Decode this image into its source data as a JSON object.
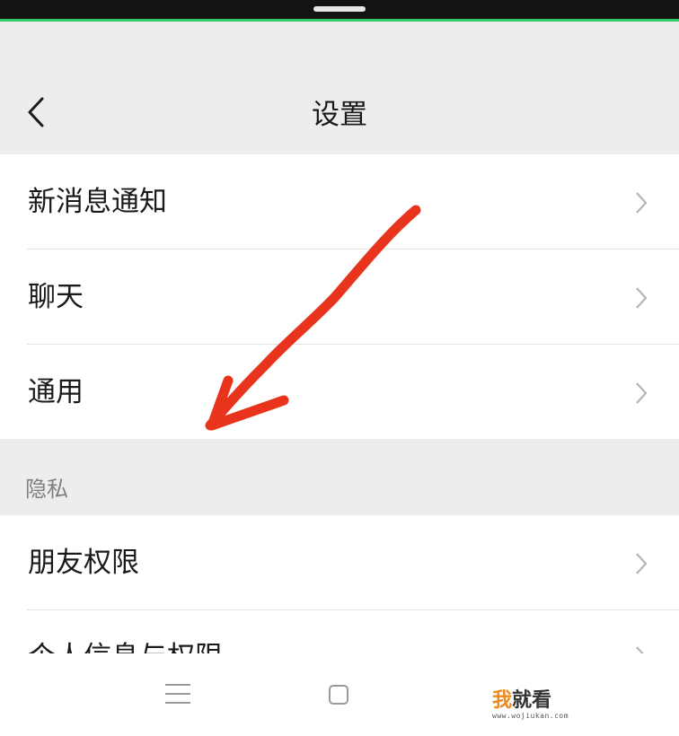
{
  "header": {
    "title": "设置",
    "back_icon": "back-chevron-icon"
  },
  "settings_group_1": {
    "items": [
      {
        "label": "新消息通知"
      },
      {
        "label": "聊天"
      },
      {
        "label": "通用"
      }
    ]
  },
  "privacy_section": {
    "title": "隐私",
    "items": [
      {
        "label": "朋友权限"
      },
      {
        "label": "个人信息与权限"
      }
    ]
  },
  "navigation_bar": {
    "icons": [
      "menu-icon",
      "home-square-icon"
    ]
  },
  "watermark": {
    "big_part1": "我",
    "big_part2": "就看",
    "small": "www.wojiukan.com"
  },
  "colors": {
    "accent_green": "#2fc76a",
    "annotation_red": "#e8341c",
    "background_gray": "#ededed"
  }
}
